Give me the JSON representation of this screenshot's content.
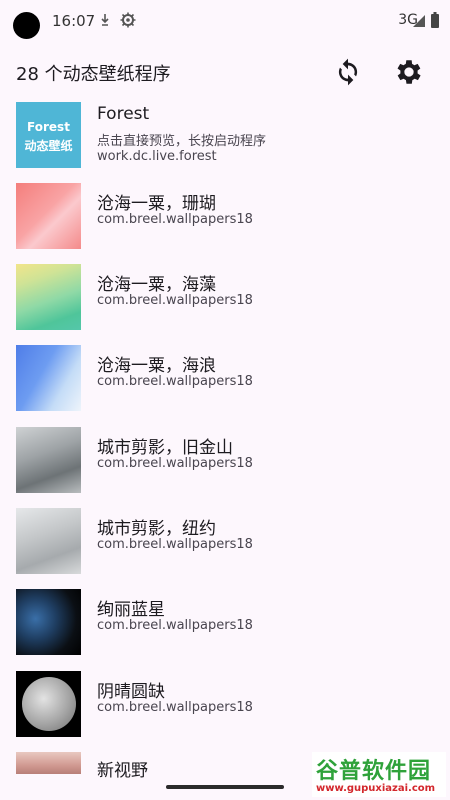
{
  "status_bar": {
    "time": "16:07",
    "network": "3G",
    "icons": [
      "camera-cutout",
      "download-arrow-icon",
      "settings-gear-icon",
      "signal-icon",
      "battery-icon"
    ]
  },
  "app_bar": {
    "title": "28 个动态壁纸程序",
    "actions": [
      "refresh-icon",
      "settings-icon"
    ]
  },
  "items": [
    {
      "title": "Forest",
      "desc": "点击直接预览，长按启动程序",
      "pkg": "work.dc.live.forest",
      "thumb_text": [
        "Forest",
        "动态壁纸"
      ]
    },
    {
      "title": "沧海一粟，珊瑚",
      "pkg": "com.breel.wallpapers18"
    },
    {
      "title": "沧海一粟，海藻",
      "pkg": "com.breel.wallpapers18"
    },
    {
      "title": "沧海一粟，海浪",
      "pkg": "com.breel.wallpapers18"
    },
    {
      "title": "城市剪影，旧金山",
      "pkg": "com.breel.wallpapers18"
    },
    {
      "title": "城市剪影，纽约",
      "pkg": "com.breel.wallpapers18"
    },
    {
      "title": "绚丽蓝星",
      "pkg": "com.breel.wallpapers18"
    },
    {
      "title": "阴晴圆缺",
      "pkg": "com.breel.wallpapers18"
    },
    {
      "title": "新视野"
    }
  ],
  "watermark": {
    "title": "谷普软件园",
    "url": "www.gupuxiazai.com"
  },
  "colors": {
    "background": "#fdf7fd",
    "watermark_green": "#2fa23a",
    "watermark_red": "#d3272c"
  }
}
